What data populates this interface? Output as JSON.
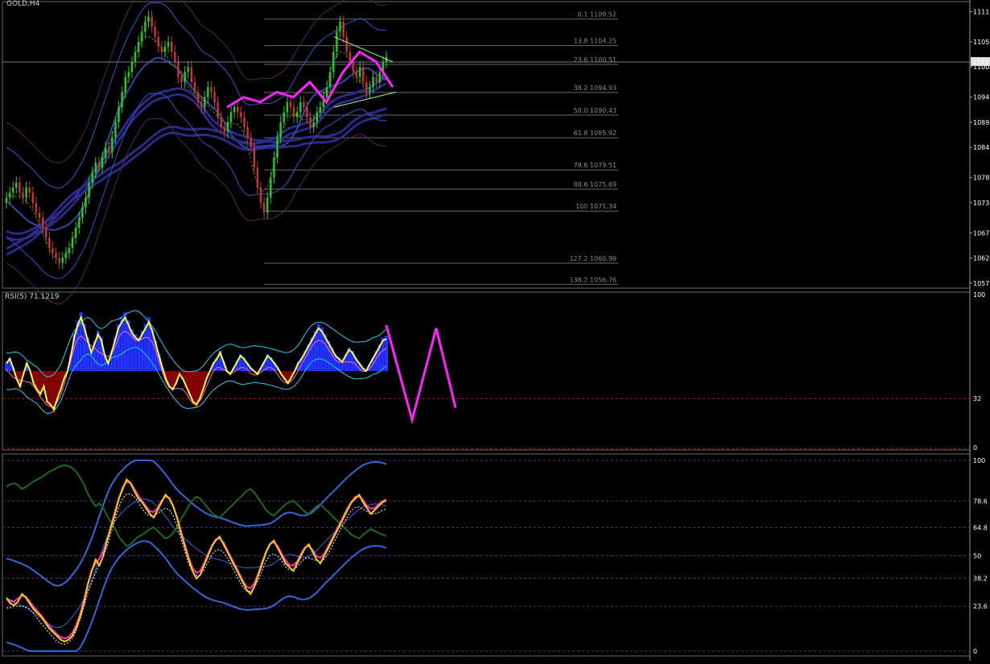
{
  "window": {
    "symbol_title": "GOLD,H4",
    "rsi_title": "RSI(5) 71.1219",
    "current_price": "1101"
  },
  "colors": {
    "background": "#000000",
    "bull_candle": "#22cc22",
    "bear_candle": "#cc3333",
    "fib_line": "#6a6a6a",
    "rsi_main": "#ffff33",
    "rsi_bands": "#22ccee",
    "hist_pos": "#2233ff",
    "hist_neg": "#8b0000",
    "forecast": "#ff22ff",
    "stoch_k": "#ffcc00",
    "stoch_d": "#ff33cc",
    "band_blue": "#3366dd",
    "green_line": "#1a6a1a"
  },
  "chart_data": [
    {
      "type": "candlestick",
      "title": "GOLD,H4",
      "ylim": [
        1056,
        1113
      ],
      "y_ticks": [
        "1111",
        "1105",
        "1100",
        "1094",
        "1089",
        "1084",
        "1078",
        "1073",
        "1067",
        "1062",
        "1057"
      ],
      "fibonacci_levels": [
        {
          "label": "0.1 1109.52",
          "price": 1109.52
        },
        {
          "label": "13.8 1104.25",
          "price": 1104.25
        },
        {
          "label": "23.6 1100.51",
          "price": 1100.51
        },
        {
          "label": "38.2 1094.93",
          "price": 1094.93
        },
        {
          "label": "50.0 1090.43",
          "price": 1090.43
        },
        {
          "label": "61.8 1085.92",
          "price": 1085.92
        },
        {
          "label": "78.6 1079.51",
          "price": 1079.51
        },
        {
          "label": "88.6 1075.69",
          "price": 1075.69
        },
        {
          "label": "100 1071.34",
          "price": 1071.34
        },
        {
          "label": "127.2 1060.96",
          "price": 1060.96
        },
        {
          "label": "138.2 1056.76",
          "price": 1056.76
        }
      ],
      "closes": [
        1074,
        1075,
        1076,
        1077,
        1075,
        1074,
        1076,
        1075,
        1073,
        1071,
        1070,
        1068,
        1066,
        1064,
        1063,
        1062,
        1061,
        1062,
        1063,
        1064,
        1066,
        1068,
        1070,
        1072,
        1074,
        1077,
        1079,
        1081,
        1080,
        1082,
        1084,
        1083,
        1086,
        1089,
        1092,
        1095,
        1098,
        1099,
        1101,
        1103,
        1105,
        1107,
        1109,
        1110,
        1108,
        1106,
        1104,
        1103,
        1104,
        1105,
        1103,
        1101,
        1098,
        1097,
        1099,
        1100,
        1097,
        1095,
        1093,
        1092,
        1094,
        1096,
        1095,
        1093,
        1090,
        1088,
        1087,
        1089,
        1091,
        1092,
        1091,
        1090,
        1088,
        1086,
        1084,
        1080,
        1076,
        1073,
        1071,
        1074,
        1078,
        1082,
        1086,
        1089,
        1091,
        1093,
        1092,
        1090,
        1091,
        1093,
        1092,
        1090,
        1088,
        1089,
        1091,
        1092,
        1094,
        1096,
        1099,
        1103,
        1107,
        1109,
        1106,
        1103,
        1101,
        1099,
        1098,
        1100,
        1097,
        1095,
        1096,
        1098,
        1097,
        1099,
        1101,
        1102
      ],
      "forecast_zigzag_prices": [
        1092,
        1094,
        1093,
        1095,
        1094,
        1097,
        1093,
        1099,
        1103,
        1101,
        1096
      ]
    },
    {
      "type": "line",
      "title": "RSI(5) 71.1219",
      "ylim": [
        0,
        100
      ],
      "y_ticks": [
        "100",
        "32",
        "0"
      ],
      "level": 32,
      "rsi": [
        55,
        58,
        52,
        45,
        40,
        48,
        55,
        50,
        42,
        38,
        35,
        40,
        30,
        28,
        25,
        32,
        38,
        45,
        50,
        60,
        72,
        80,
        85,
        78,
        70,
        62,
        68,
        74,
        70,
        60,
        55,
        62,
        70,
        78,
        82,
        85,
        80,
        75,
        72,
        70,
        74,
        78,
        82,
        76,
        68,
        60,
        52,
        45,
        40,
        38,
        42,
        48,
        45,
        40,
        35,
        30,
        28,
        32,
        38,
        45,
        50,
        55,
        58,
        62,
        56,
        50,
        48,
        52,
        56,
        60,
        58,
        55,
        52,
        50,
        48,
        52,
        56,
        60,
        58,
        55,
        52,
        48,
        45,
        42,
        46,
        50,
        55,
        58,
        62,
        66,
        70,
        74,
        78,
        76,
        72,
        68,
        64,
        60,
        58,
        56,
        60,
        64,
        62,
        58,
        55,
        52,
        50,
        54,
        58,
        62,
        66,
        70,
        71
      ]
    },
    {
      "type": "line",
      "title": "",
      "ylim": [
        0,
        100
      ],
      "y_ticks": [
        "100",
        "78.6",
        "64.8",
        "50",
        "38.2",
        "23.6",
        "0"
      ],
      "levels": [
        100,
        78.6,
        64.8,
        50,
        38.2,
        23.6,
        0
      ],
      "stoch": [
        28,
        25,
        24,
        26,
        30,
        28,
        25,
        22,
        20,
        18,
        15,
        12,
        10,
        8,
        6,
        5,
        6,
        8,
        12,
        18,
        25,
        35,
        42,
        48,
        45,
        50,
        58,
        65,
        72,
        80,
        85,
        90,
        88,
        84,
        80,
        78,
        75,
        72,
        70,
        74,
        78,
        82,
        80,
        76,
        70,
        62,
        55,
        48,
        42,
        38,
        40,
        45,
        50,
        55,
        58,
        60,
        56,
        52,
        48,
        44,
        40,
        36,
        32,
        30,
        34,
        40,
        46,
        52,
        56,
        58,
        54,
        50,
        46,
        44,
        42,
        46,
        50,
        54,
        56,
        52,
        48,
        46,
        50,
        54,
        58,
        62,
        66,
        70,
        74,
        78,
        80,
        82,
        78,
        75,
        72,
        74,
        76,
        78,
        79
      ]
    }
  ]
}
